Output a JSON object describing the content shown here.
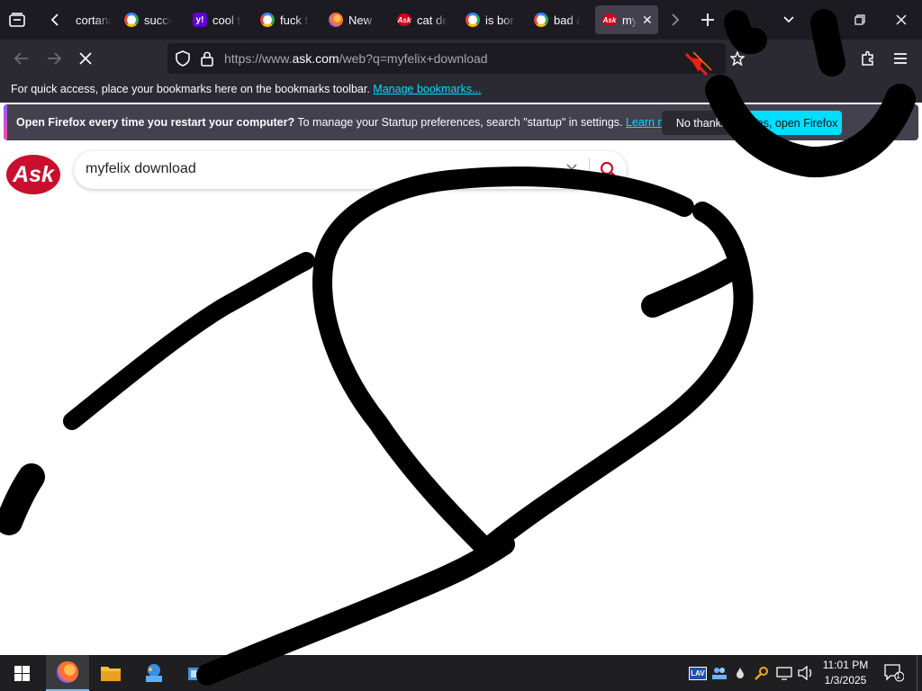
{
  "browser": {
    "tabs": [
      {
        "title": "cortana",
        "icon": "blank-page-icon"
      },
      {
        "title": "success",
        "icon": "google-icon"
      },
      {
        "title": "cool t",
        "icon": "yahoo-icon"
      },
      {
        "title": "fuck t",
        "icon": "google-icon"
      },
      {
        "title": "New T",
        "icon": "firefox-icon"
      },
      {
        "title": "cat de",
        "icon": "ask-icon"
      },
      {
        "title": "is bor",
        "icon": "google-icon"
      },
      {
        "title": "bad a",
        "icon": "google-icon"
      },
      {
        "title": "myfelix",
        "icon": "ask-icon",
        "active": true
      }
    ],
    "url_prefix": "https://www.",
    "url_domain": "ask.com",
    "url_rest": "/web?q=myfelix+download",
    "bookmarks_bar": {
      "text": "For quick access, place your bookmarks here on the bookmarks toolbar.",
      "link": "Manage bookmarks..."
    },
    "notification": {
      "bold": "Open Firefox every time you restart your computer?",
      "text": "To manage your Startup preferences, search \"startup\" in settings.",
      "link": "Learn more",
      "no_button": "No thanks",
      "yes_button": "Yes, open Firefox"
    }
  },
  "page": {
    "logo": "Ask",
    "search_query": "myfelix download"
  },
  "taskbar": {
    "time": "11:01 PM",
    "date": "1/3/2025",
    "notification_count": "1"
  },
  "colors": {
    "ask_red": "#c8102e",
    "accent_cyan": "#00ddff",
    "firefox_dark": "#1c1b22"
  }
}
